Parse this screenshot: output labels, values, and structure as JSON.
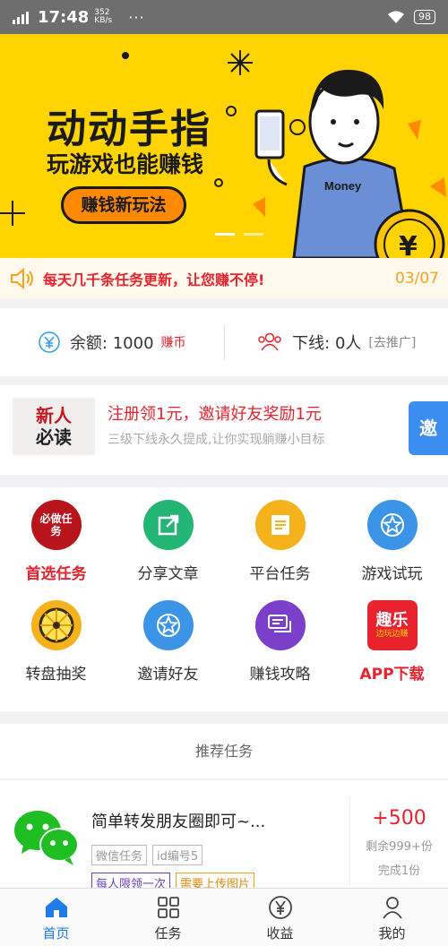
{
  "statusbar": {
    "network": "G",
    "time": "17:48",
    "speed_value": "352",
    "speed_unit": "KB/s",
    "dots": "···",
    "battery": "98"
  },
  "banner": {
    "title": "动动手指",
    "subtitle": "玩游戏也能赚钱",
    "button": "赚钱新玩法",
    "shirt_text": "Money",
    "coin_symbol": "¥",
    "active_slide": 1,
    "slide_count": 2
  },
  "notice": {
    "text": "每天几千条任务更新，让您赚不停!",
    "counter": "03/07"
  },
  "balance": {
    "balance_label": "余额: 1000",
    "balance_unit": "赚币",
    "downline_label": "下线: 0人",
    "promote_link": "[去推广]"
  },
  "newbie": {
    "badge_line1": "新人",
    "badge_line2": "必读",
    "title": "注册领1元，邀请好友奖励1元",
    "subtitle": "三级下线永久提成,让你实现躺赚小目标",
    "tag": "邀"
  },
  "grid": {
    "items": [
      {
        "label": "首选任务",
        "icon": "seal-icon",
        "emblem": "必做任务"
      },
      {
        "label": "分享文章",
        "icon": "share-icon",
        "color": "#22b573"
      },
      {
        "label": "平台任务",
        "icon": "document-icon",
        "color": "#f5b21c"
      },
      {
        "label": "游戏试玩",
        "icon": "star-badge-icon",
        "color": "#3b94e6"
      },
      {
        "label": "转盘抽奖",
        "icon": "wheel-icon",
        "color": "#f5b21c"
      },
      {
        "label": "邀请好友",
        "icon": "star-badge-icon",
        "color": "#3b94e6"
      },
      {
        "label": "赚钱攻略",
        "icon": "chat-icon",
        "color": "#7b3fc9"
      },
      {
        "label": "APP下载",
        "icon": "app-logo-icon",
        "logo_text": "趣乐",
        "logo_sub": "边玩边赚"
      }
    ]
  },
  "recommend": {
    "heading": "推荐任务",
    "task": {
      "title": "简单转发朋友圈即可~...",
      "tag1": "微信任务",
      "tag2": "id编号5",
      "tag3": "每人限领一次",
      "tag4": "需要上传图片",
      "price": "+500",
      "remain": "剩余999+份",
      "done": "完成1份"
    }
  },
  "tabbar": {
    "items": [
      {
        "label": "首页",
        "icon": "home-icon"
      },
      {
        "label": "任务",
        "icon": "grid-icon"
      },
      {
        "label": "收益",
        "icon": "yen-circle-icon"
      },
      {
        "label": "我的",
        "icon": "user-icon"
      }
    ]
  },
  "colors": {
    "accent_red": "#e8232e",
    "banner_yellow": "#ffd400",
    "tab_active": "#1e7ce8"
  }
}
